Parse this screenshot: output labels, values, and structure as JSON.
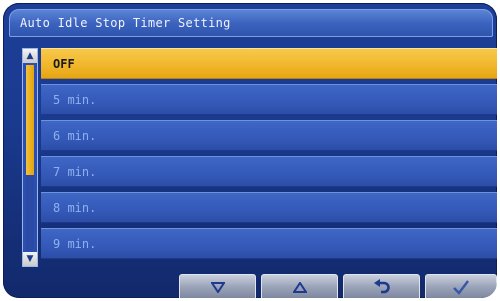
{
  "window": {
    "title": "Auto Idle Stop Timer Setting"
  },
  "list": {
    "items": [
      {
        "label": "OFF",
        "selected": true
      },
      {
        "label": "5 min.",
        "selected": false
      },
      {
        "label": "6 min.",
        "selected": false
      },
      {
        "label": "7 min.",
        "selected": false
      },
      {
        "label": "8 min.",
        "selected": false
      },
      {
        "label": "9 min.",
        "selected": false
      }
    ]
  },
  "scrollbar": {
    "up_glyph": "▲",
    "down_glyph": "▼",
    "position_fraction": 0.0
  },
  "toolbar": {
    "buttons": [
      {
        "icon": "down-arrow-icon"
      },
      {
        "icon": "up-arrow-icon"
      },
      {
        "icon": "return-icon"
      },
      {
        "icon": "checkmark-icon"
      }
    ]
  },
  "colors": {
    "screen_bg": "#1a3a8e",
    "row_bg": "#3459b8",
    "row_text": "#8fb0ee",
    "selected_bg": "#f0b529",
    "selected_text": "#1a1a1a",
    "title_text": "#f2f4ff"
  }
}
